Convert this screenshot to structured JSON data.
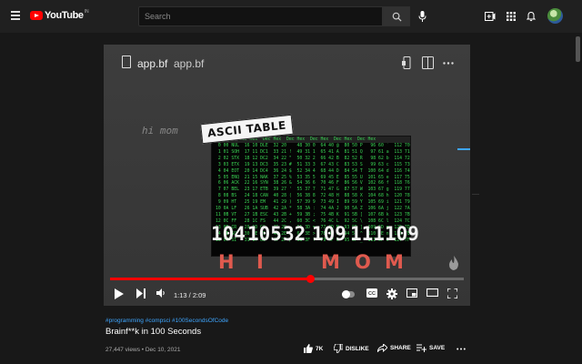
{
  "header": {
    "logo_text": "YouTube",
    "logo_country": "IN",
    "search_placeholder": "Search"
  },
  "editor": {
    "file_name": "app.bf",
    "file_path": "app.bf",
    "code_comment": "hi mom"
  },
  "overlay": {
    "ascii_label": "ASCII TABLE",
    "ascii_header": "Dec Hex  Dec Hex  Dec Hex  Dec Hex  Dec Hex  Dec Hex  Dec Hex",
    "codes": [
      "104",
      "105",
      "32",
      "109",
      "111",
      "109"
    ],
    "letters": [
      "H",
      "I",
      "M",
      "O",
      "M"
    ]
  },
  "player": {
    "time": "1:13 / 2:09",
    "progress": 0.566,
    "accent_color": "#ff0000"
  },
  "video": {
    "hashtags": "#programming #compsci #100SecondsOfCode",
    "title": "Brainf**k in 100 Seconds",
    "meta": "27,447 views • Dec 10, 2021",
    "like_label": "7K",
    "dislike_label": "DISLIKE",
    "share_label": "SHARE",
    "save_label": "SAVE"
  }
}
